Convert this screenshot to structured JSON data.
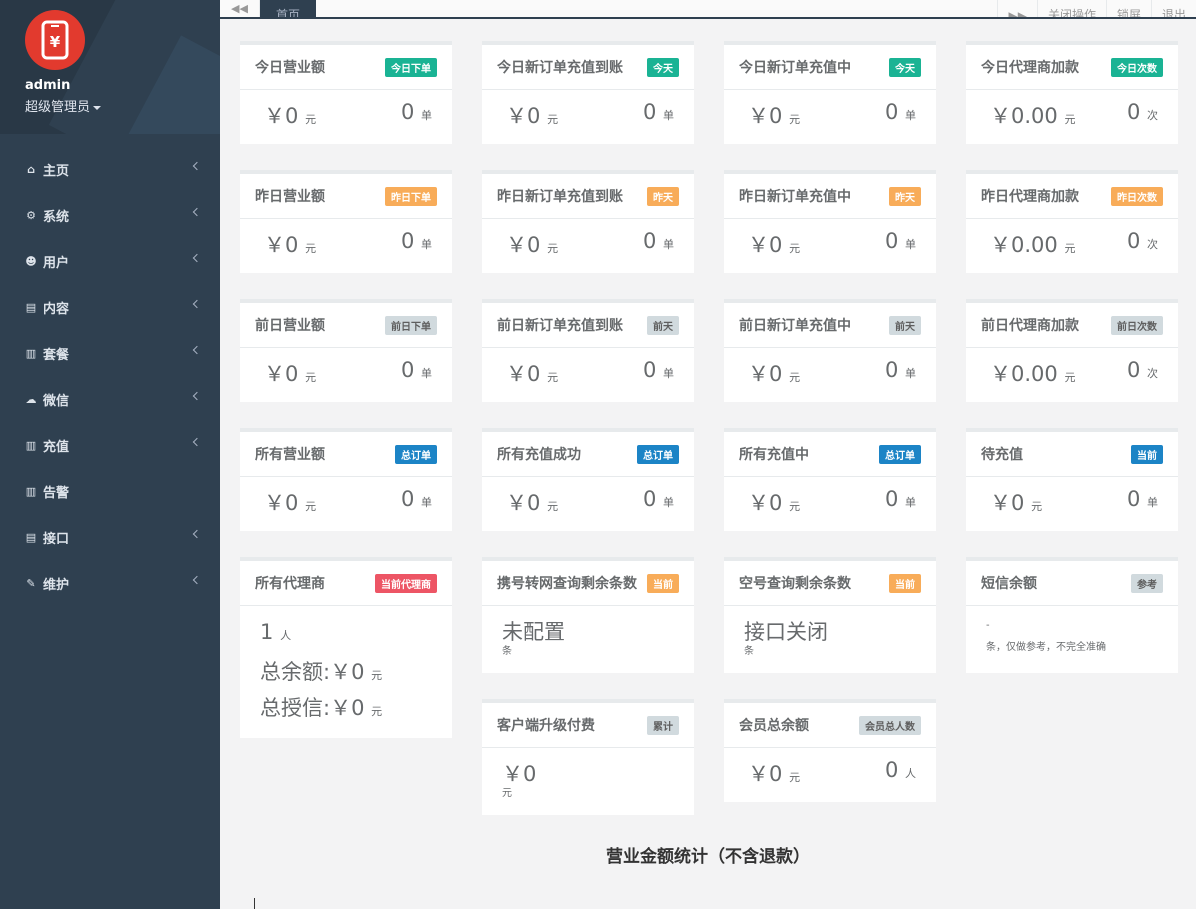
{
  "user": {
    "name": "admin",
    "role": "超级管理员"
  },
  "nav": [
    {
      "label": "主页",
      "icon": "home-icon"
    },
    {
      "label": "系统",
      "icon": "cogs-icon"
    },
    {
      "label": "用户",
      "icon": "users-icon"
    },
    {
      "label": "内容",
      "icon": "file-icon"
    },
    {
      "label": "套餐",
      "icon": "file-text-icon"
    },
    {
      "label": "微信",
      "icon": "wechat-icon"
    },
    {
      "label": "充值",
      "icon": "file-text-icon"
    },
    {
      "label": "告警",
      "icon": "file-text-icon"
    },
    {
      "label": "接口",
      "icon": "file-icon"
    },
    {
      "label": "维护",
      "icon": "magic-icon"
    }
  ],
  "topbar": {
    "tab": "首页",
    "close_ops": "关闭操作",
    "lock": "锁屏",
    "logout": "退出"
  },
  "rows": [
    [
      {
        "title": "今日营业额",
        "label": "今日下单",
        "color": "primary",
        "amount": "￥0",
        "unit": "元",
        "count": "0",
        "count_unit": "单"
      },
      {
        "title": "今日新订单充值到账",
        "label": "今天",
        "color": "primary",
        "amount": "￥0",
        "unit": "元",
        "count": "0",
        "count_unit": "单"
      },
      {
        "title": "今日新订单充值中",
        "label": "今天",
        "color": "primary",
        "amount": "￥0",
        "unit": "元",
        "count": "0",
        "count_unit": "单"
      },
      {
        "title": "今日代理商加款",
        "label": "今日次数",
        "color": "primary",
        "amount": "￥0.00",
        "unit": "元",
        "count": "0",
        "count_unit": "次"
      }
    ],
    [
      {
        "title": "昨日营业额",
        "label": "昨日下单",
        "color": "warning",
        "amount": "￥0",
        "unit": "元",
        "count": "0",
        "count_unit": "单"
      },
      {
        "title": "昨日新订单充值到账",
        "label": "昨天",
        "color": "warning",
        "amount": "￥0",
        "unit": "元",
        "count": "0",
        "count_unit": "单"
      },
      {
        "title": "昨日新订单充值中",
        "label": "昨天",
        "color": "warning",
        "amount": "￥0",
        "unit": "元",
        "count": "0",
        "count_unit": "单"
      },
      {
        "title": "昨日代理商加款",
        "label": "昨日次数",
        "color": "warning",
        "amount": "￥0.00",
        "unit": "元",
        "count": "0",
        "count_unit": "次"
      }
    ],
    [
      {
        "title": "前日营业额",
        "label": "前日下单",
        "color": "default",
        "amount": "￥0",
        "unit": "元",
        "count": "0",
        "count_unit": "单"
      },
      {
        "title": "前日新订单充值到账",
        "label": "前天",
        "color": "default",
        "amount": "￥0",
        "unit": "元",
        "count": "0",
        "count_unit": "单"
      },
      {
        "title": "前日新订单充值中",
        "label": "前天",
        "color": "default",
        "amount": "￥0",
        "unit": "元",
        "count": "0",
        "count_unit": "单"
      },
      {
        "title": "前日代理商加款",
        "label": "前日次数",
        "color": "default",
        "amount": "￥0.00",
        "unit": "元",
        "count": "0",
        "count_unit": "次"
      }
    ],
    [
      {
        "title": "所有营业额",
        "label": "总订单",
        "color": "success",
        "amount": "￥0",
        "unit": "元",
        "count": "0",
        "count_unit": "单"
      },
      {
        "title": "所有充值成功",
        "label": "总订单",
        "color": "success",
        "amount": "￥0",
        "unit": "元",
        "count": "0",
        "count_unit": "单"
      },
      {
        "title": "所有充值中",
        "label": "总订单",
        "color": "success",
        "amount": "￥0",
        "unit": "元",
        "count": "0",
        "count_unit": "单"
      },
      {
        "title": "待充值",
        "label": "当前",
        "color": "success",
        "amount": "￥0",
        "unit": "元",
        "count": "0",
        "count_unit": "单"
      }
    ]
  ],
  "agent": {
    "title": "所有代理商",
    "label": "当前代理商",
    "count": "1",
    "count_unit": "人",
    "balance_label": "总余额:",
    "balance": "￥0",
    "credit_label": "总授信:",
    "credit": "￥0",
    "unit": "元"
  },
  "port_query": {
    "title": "携号转网查询剩余条数",
    "label": "当前",
    "value": "未配置",
    "unit": "条"
  },
  "empty_query": {
    "title": "空号查询剩余条数",
    "label": "当前",
    "value": "接口关闭",
    "unit": "条"
  },
  "sms": {
    "title": "短信余额",
    "label": "参考",
    "value": "-",
    "note": "条，仅做参考，不完全准确"
  },
  "upgrade": {
    "title": "客户端升级付费",
    "label": "累计",
    "value": "￥0",
    "unit": "元"
  },
  "member": {
    "title": "会员总余额",
    "label": "会员总人数",
    "amount": "￥0",
    "unit": "元",
    "count": "0",
    "count_unit": "人"
  },
  "section_title": "营业金额统计（不含退款）",
  "colors": {
    "primary": "#1ab394",
    "warning": "#f8ac59",
    "default": "#d1dade",
    "success": "#1c84c6",
    "danger": "#ed5565",
    "sidebar": "#2f4050"
  }
}
